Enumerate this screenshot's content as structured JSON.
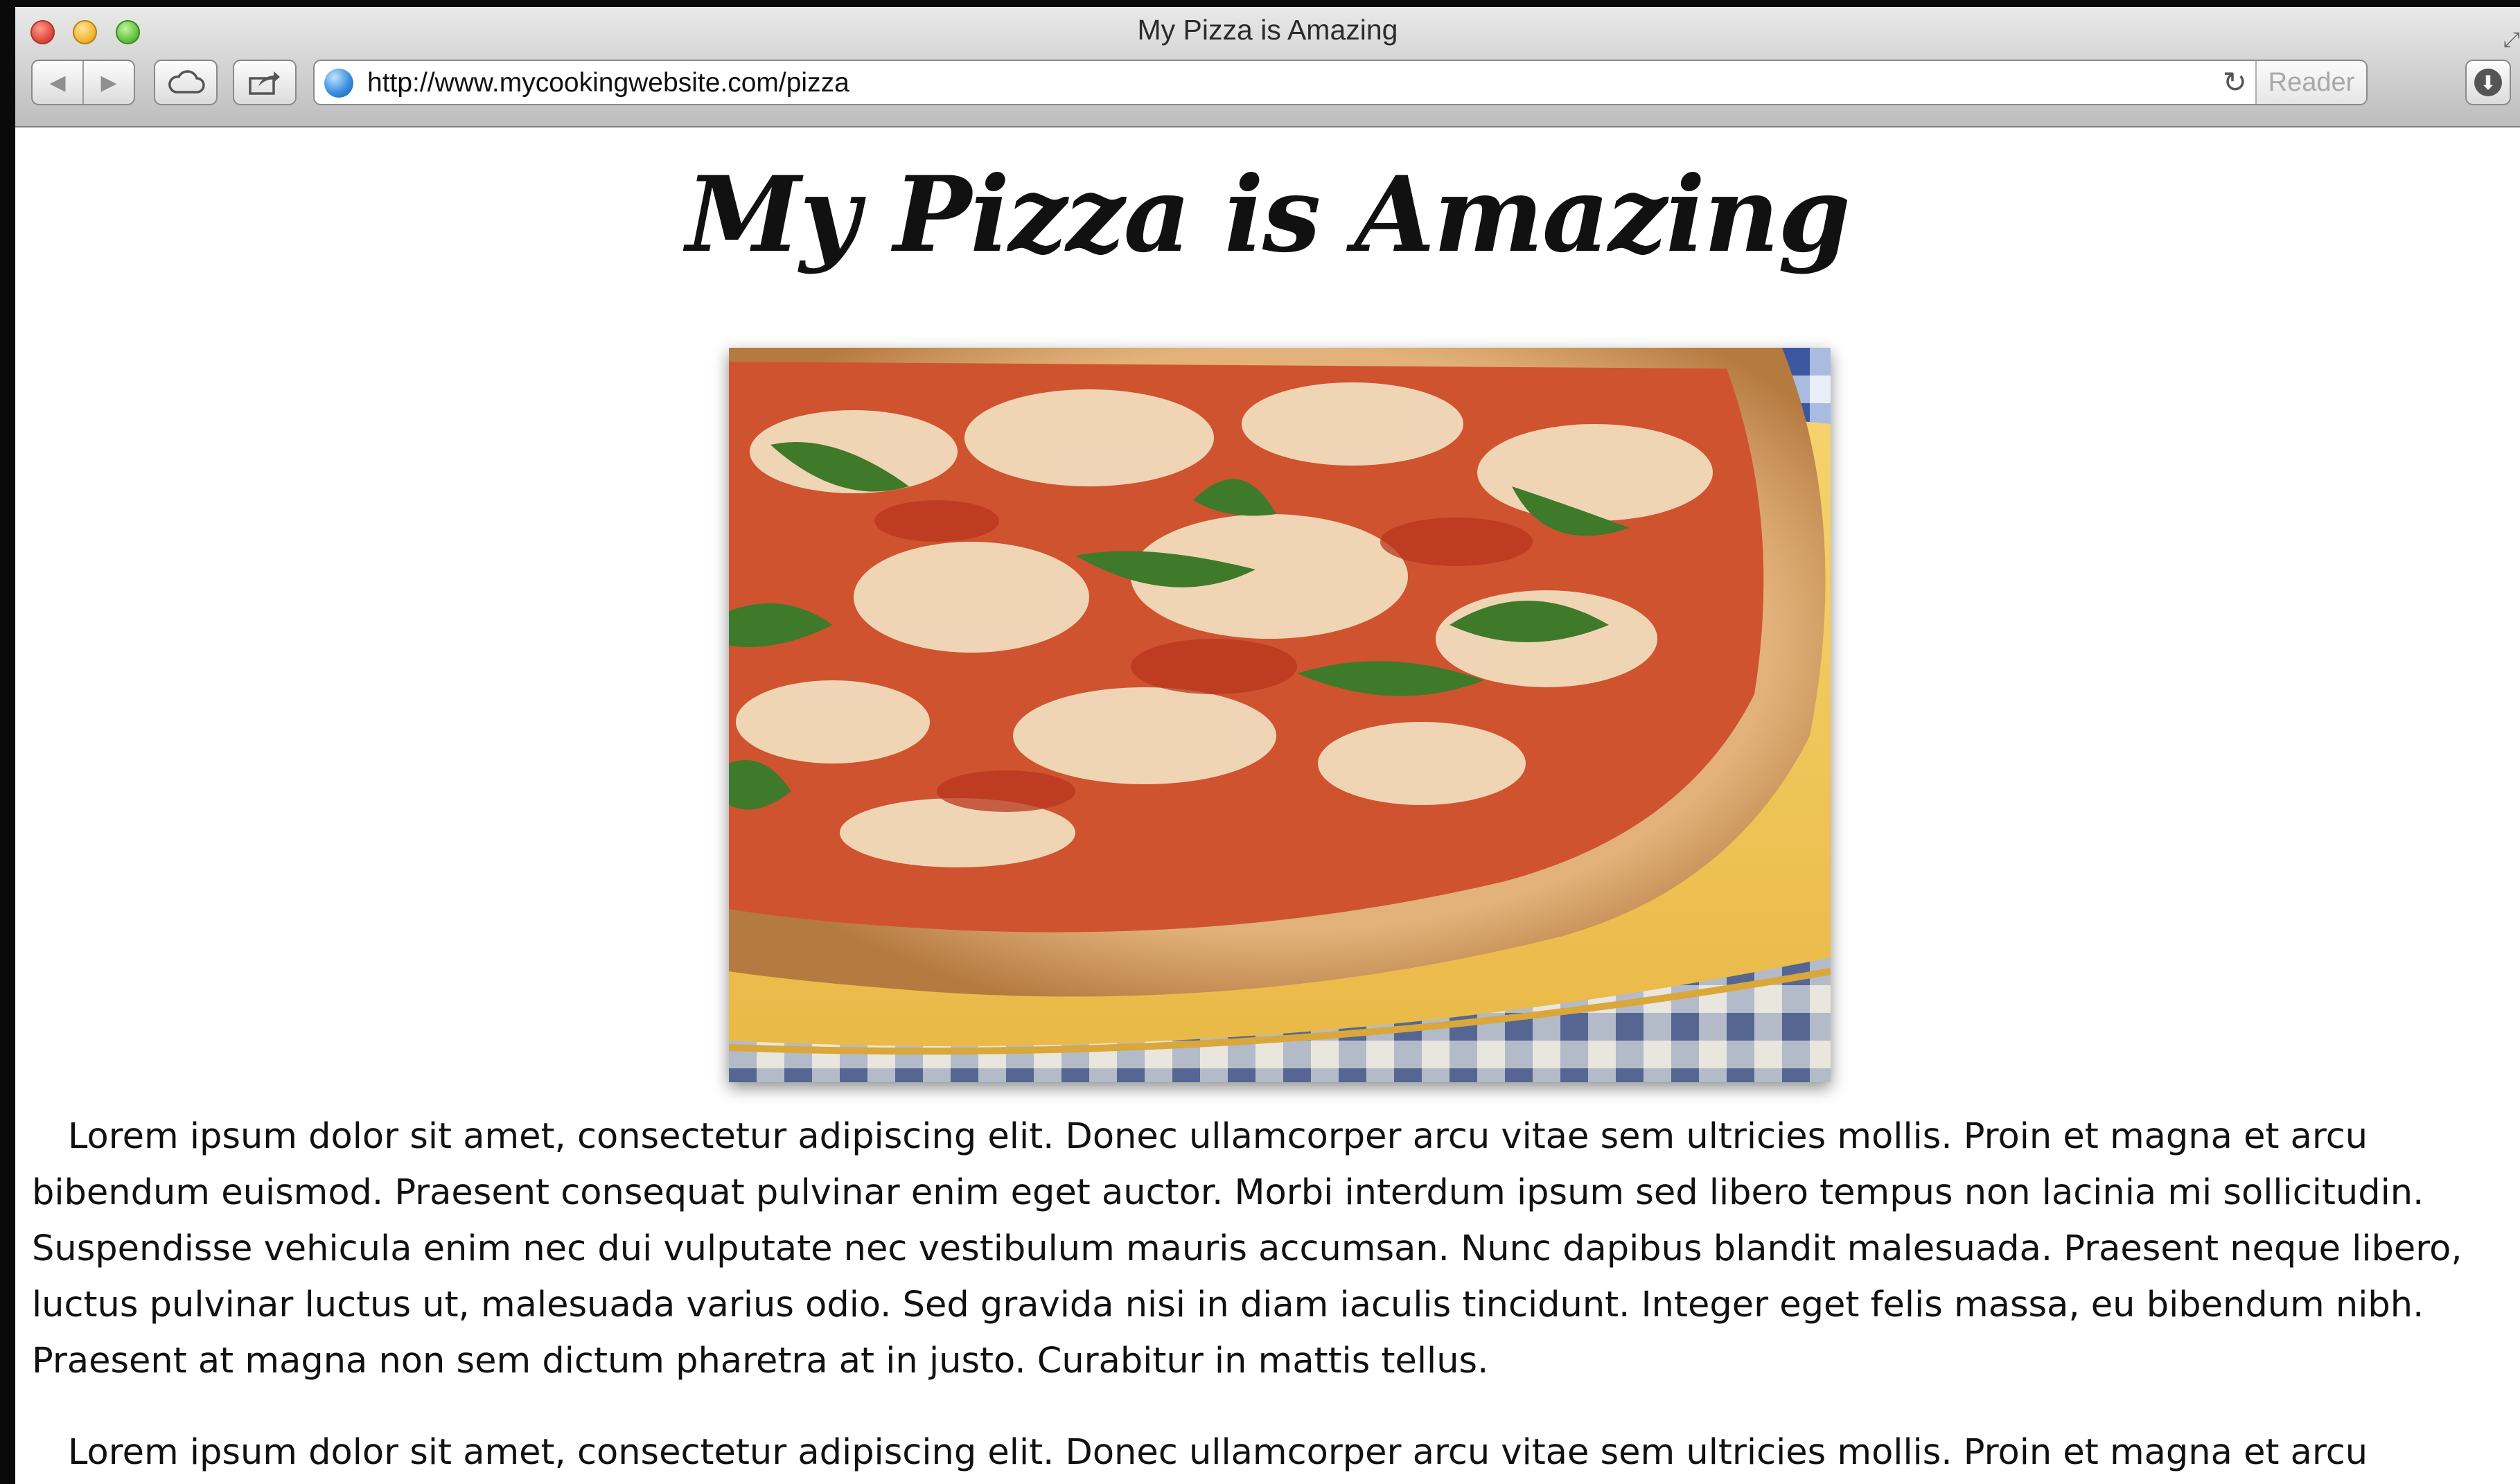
{
  "browser": {
    "window_title": "My Pizza is Amazing",
    "url": "http://www.mycookingwebsite.com/pizza",
    "reader_label": "Reader",
    "back_glyph": "◀",
    "forward_glyph": "▶",
    "reload_glyph": "↻",
    "download_glyph": "⬇",
    "fullscreen_glyph": "⤢",
    "icons": [
      "back-icon",
      "forward-icon",
      "cloud-icon",
      "share-icon",
      "globe-icon",
      "reload-icon",
      "download-icon"
    ]
  },
  "page": {
    "heading": "My Pizza is Amazing",
    "paragraphs": [
      "Lorem ipsum dolor sit amet, consectetur adipiscing elit. Donec ullamcorper arcu vitae sem ultricies mollis. Proin et magna et arcu bibendum euismod. Praesent consequat pulvinar enim eget auctor. Morbi interdum ipsum sed libero tempus non lacinia mi sollicitudin. Suspendisse vehicula enim nec dui vulputate nec vestibulum mauris accumsan. Nunc dapibus blandit malesuada. Praesent neque libero, luctus pulvinar luctus ut, malesuada varius odio. Sed gravida nisi in diam iaculis tincidunt. Integer eget felis massa, eu bibendum nibh. Praesent at magna non sem dictum pharetra at in justo. Curabitur in mattis tellus.",
      "Lorem ipsum dolor sit amet, consectetur adipiscing elit. Donec ullamcorper arcu vitae sem ultricies mollis. Proin et magna et arcu"
    ]
  },
  "colors": {
    "plate": "#f2c75a",
    "sauce": "#c9412a",
    "crust": "#d9a56a",
    "basil": "#3f7a2a",
    "tablecloth": "#3b57a0"
  }
}
